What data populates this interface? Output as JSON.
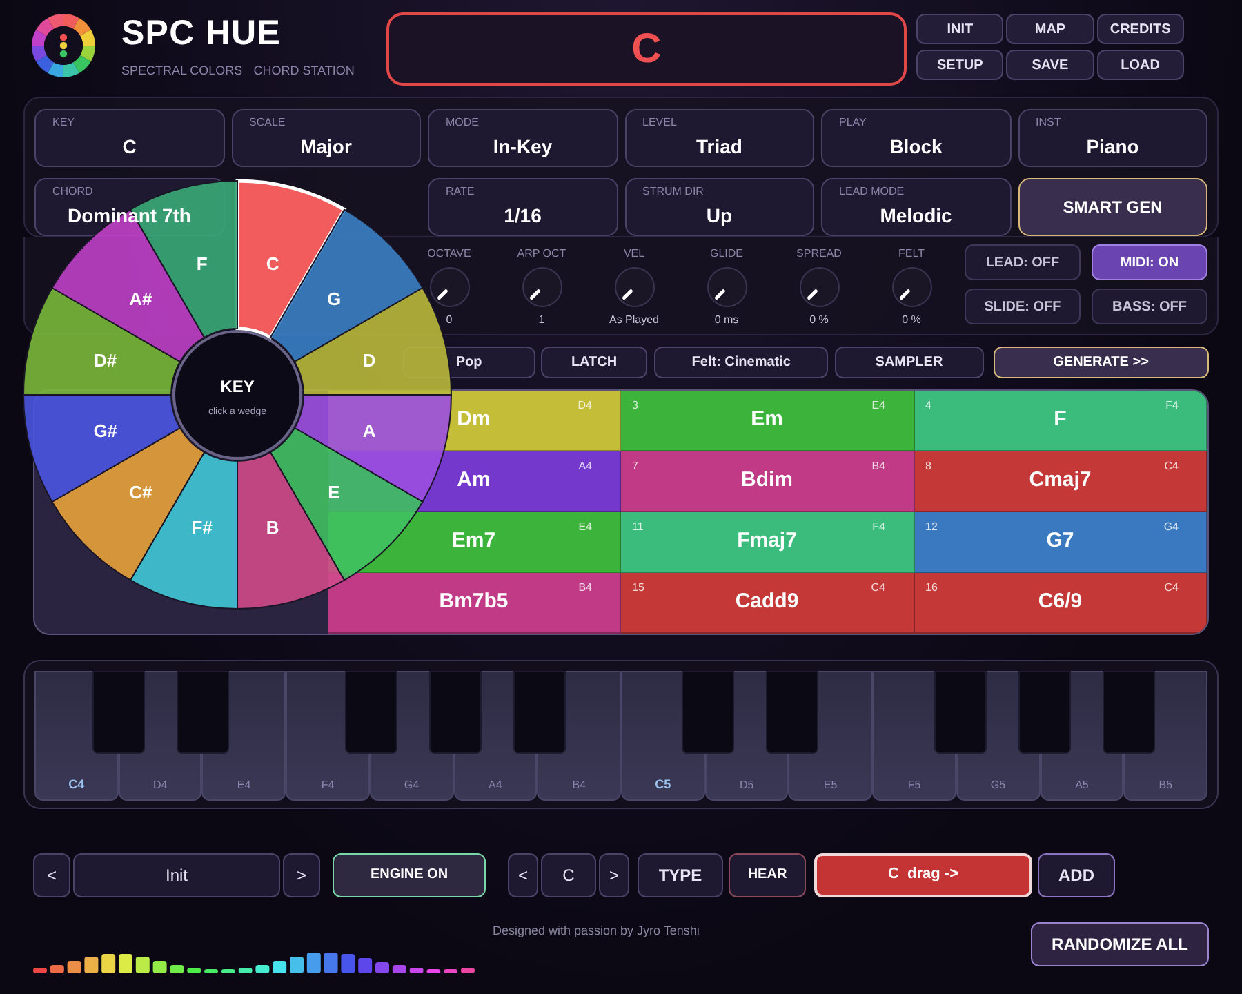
{
  "header": {
    "title": "SPC HUE",
    "subtitles": [
      "SPECTRAL COLORS",
      "CHORD STATION"
    ]
  },
  "display": {
    "text": "C"
  },
  "menu_buttons": [
    "INIT",
    "MAP",
    "CREDITS",
    "SETUP",
    "SAVE",
    "LOAD"
  ],
  "fields": [
    {
      "label": "KEY",
      "value": "C"
    },
    {
      "label": "SCALE",
      "value": "Major"
    },
    {
      "label": "MODE",
      "value": "In-Key"
    },
    {
      "label": "LEVEL",
      "value": "Triad"
    },
    {
      "label": "PLAY",
      "value": "Block"
    },
    {
      "label": "INST",
      "value": "Piano"
    },
    {
      "label": "CHORD",
      "value": "Dominant 7th"
    },
    {
      "label": "RATE",
      "value": "1/16"
    },
    {
      "label": "STRUM DIR",
      "value": "Up"
    },
    {
      "label": "LEAD MODE",
      "value": "Melodic"
    }
  ],
  "smart_gen": "SMART GEN",
  "knobs": [
    {
      "label": "OCTAVE",
      "value": "0"
    },
    {
      "label": "ARP OCT",
      "value": "1"
    },
    {
      "label": "VEL",
      "value": "As Played"
    },
    {
      "label": "GLIDE",
      "value": "0 ms"
    },
    {
      "label": "SPREAD",
      "value": "0 %"
    },
    {
      "label": "FELT",
      "value": "0 %"
    }
  ],
  "toggles": [
    {
      "label": "LEAD: OFF",
      "on": false
    },
    {
      "label": "MIDI: ON",
      "on": true
    },
    {
      "label": "SLIDE: OFF",
      "on": false
    },
    {
      "label": "BASS: OFF",
      "on": false
    }
  ],
  "actions": [
    {
      "label": "Pop",
      "kind": "plain"
    },
    {
      "label": "LATCH",
      "kind": "plain"
    },
    {
      "label": "Felt: Cinematic",
      "kind": "plain"
    },
    {
      "label": "SAMPLER",
      "kind": "plain"
    },
    {
      "label": "GENERATE >>",
      "kind": "primary"
    }
  ],
  "chord_grid": [
    {
      "chord": "Dm",
      "note": "D4",
      "color": "#c4bd38"
    },
    {
      "number": "3",
      "chord": "Em",
      "note": "E4",
      "color": "#3cb43c"
    },
    {
      "number": "4",
      "chord": "F",
      "note": "F4",
      "color": "#3cbc7c"
    },
    {
      "chord": "Am",
      "note": "A4",
      "color": "#7438cc"
    },
    {
      "number": "7",
      "chord": "Bdim",
      "note": "B4",
      "color": "#c03a86"
    },
    {
      "number": "8",
      "chord": "Cmaj7",
      "note": "C4",
      "color": "#c43838"
    },
    {
      "chord": "Em7",
      "note": "E4",
      "color": "#3cb43c"
    },
    {
      "number": "11",
      "chord": "Fmaj7",
      "note": "F4",
      "color": "#3cbc7c"
    },
    {
      "number": "12",
      "chord": "G7",
      "note": "G4",
      "color": "#3a78c0"
    },
    {
      "chord": "Bm7b5",
      "note": "B4",
      "color": "#c03a86"
    },
    {
      "number": "15",
      "chord": "Cadd9",
      "note": "C4",
      "color": "#c43838"
    },
    {
      "number": "16",
      "chord": "C6/9",
      "note": "C4",
      "color": "#c43838"
    }
  ],
  "keyboard": [
    {
      "label": "C4",
      "kind": "octave"
    },
    {
      "label": "D4",
      "kind": "note"
    },
    {
      "label": "E4",
      "kind": "note"
    },
    {
      "label": "F4",
      "kind": "note"
    },
    {
      "label": "G4",
      "kind": "note"
    },
    {
      "label": "A4",
      "kind": "note"
    },
    {
      "label": "B4",
      "kind": "note"
    },
    {
      "label": "C5",
      "kind": "octave"
    },
    {
      "label": "D5",
      "kind": "note"
    },
    {
      "label": "E5",
      "kind": "note"
    },
    {
      "label": "F5",
      "kind": "note"
    },
    {
      "label": "G5",
      "kind": "note"
    },
    {
      "label": "A5",
      "kind": "note"
    },
    {
      "label": "B5",
      "kind": "note"
    }
  ],
  "preset": {
    "prev": "<",
    "value": "Init",
    "next": ">"
  },
  "engine": {
    "label": "ENGINE ON",
    "on": true
  },
  "chord_select": {
    "prev": "<",
    "value": "C",
    "next": ">"
  },
  "type_button": "TYPE",
  "hear_button": "HEAR",
  "drag_button": "C  drag ->",
  "add_button": "ADD",
  "credit": "Designed with passion by Jyro Tenshi",
  "randomize_button": "RANDOMIZE ALL",
  "wheel": {
    "title": "KEY",
    "hint": "click a wedge",
    "wedges": [
      {
        "label": "C",
        "selected": true
      },
      {
        "label": "G",
        "selected": false
      },
      {
        "label": "D",
        "selected": false
      },
      {
        "label": "A",
        "selected": false
      },
      {
        "label": "E",
        "selected": false
      },
      {
        "label": "B",
        "selected": false
      },
      {
        "label": "F#",
        "selected": false
      },
      {
        "label": "C#",
        "selected": false
      },
      {
        "label": "G#",
        "selected": false
      },
      {
        "label": "D#",
        "selected": false
      },
      {
        "label": "A#",
        "selected": false
      },
      {
        "label": "F",
        "selected": false
      }
    ]
  }
}
